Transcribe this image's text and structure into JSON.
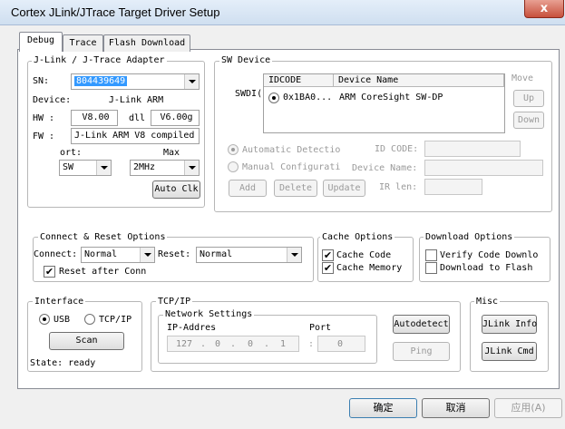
{
  "window": {
    "title": "Cortex JLink/JTrace Target Driver Setup",
    "close_glyph": "x"
  },
  "tabs": [
    {
      "label": "Debug"
    },
    {
      "label": "Trace"
    },
    {
      "label": "Flash Download"
    }
  ],
  "adapter": {
    "title": "J-Link / J-Trace Adapter",
    "sn_label": "SN:",
    "sn_value": "804439649",
    "device_label": "Device:",
    "device_value": "J-Link ARM",
    "hw_label": "HW :",
    "hw_value": "V8.00",
    "dll_label": "dll",
    "dll_value": "V6.00g",
    "fw_label": "FW :",
    "fw_value": "J-Link ARM V8 compiled I",
    "port_label": "ort:",
    "port_value": "SW",
    "max_label": "Max",
    "max_value": "2MHz",
    "autoclk_label": "Auto Clk"
  },
  "sw_device": {
    "title": "SW Device",
    "side_label": "SWDI(",
    "columns": [
      "IDCODE",
      "Device Name"
    ],
    "rows": [
      {
        "idcode": "0x1BA0...",
        "name": "ARM CoreSight SW-DP"
      }
    ],
    "move_label": "Move",
    "up_label": "Up",
    "down_label": "Down",
    "auto_detect_label": "Automatic Detectio",
    "manual_label": "Manual Configurati",
    "id_code_label": "ID CODE:",
    "device_name_label": "Device Name:",
    "ir_len_label": "IR len:",
    "add_label": "Add",
    "delete_label": "Delete",
    "update_label": "Update"
  },
  "connect": {
    "title": "Connect & Reset Options",
    "connect_label": "Connect:",
    "connect_value": "Normal",
    "reset_label": "Reset:",
    "reset_value": "Normal",
    "reset_after_label": "Reset after Conn",
    "reset_after_checked": true
  },
  "cache": {
    "title": "Cache Options",
    "code_label": "Cache Code",
    "code_checked": true,
    "memory_label": "Cache Memory",
    "memory_checked": true
  },
  "download": {
    "title": "Download Options",
    "verify_label": "Verify Code Downlo",
    "verify_checked": false,
    "flash_label": "Download to Flash",
    "flash_checked": false
  },
  "interface": {
    "title": "Interface",
    "usb_label": "USB",
    "tcpip_label": "TCP/IP",
    "selected": "USB",
    "scan_label": "Scan",
    "state_label": "State: ready"
  },
  "tcpip": {
    "title": "TCP/IP",
    "network_title": "Network Settings",
    "ip_label": "IP-Addres",
    "ip_parts": [
      "127",
      "0",
      "0",
      "1"
    ],
    "port_label": "Port",
    "port_value": "0",
    "autodetect_label": "Autodetect",
    "ping_label": "Ping"
  },
  "misc": {
    "title": "Misc",
    "jlink_info_label": "JLink Info",
    "jlink_cmd_label": "JLink Cmd"
  },
  "footer": {
    "ok_label": "确定",
    "cancel_label": "取消",
    "apply_label": "应用(A)"
  }
}
